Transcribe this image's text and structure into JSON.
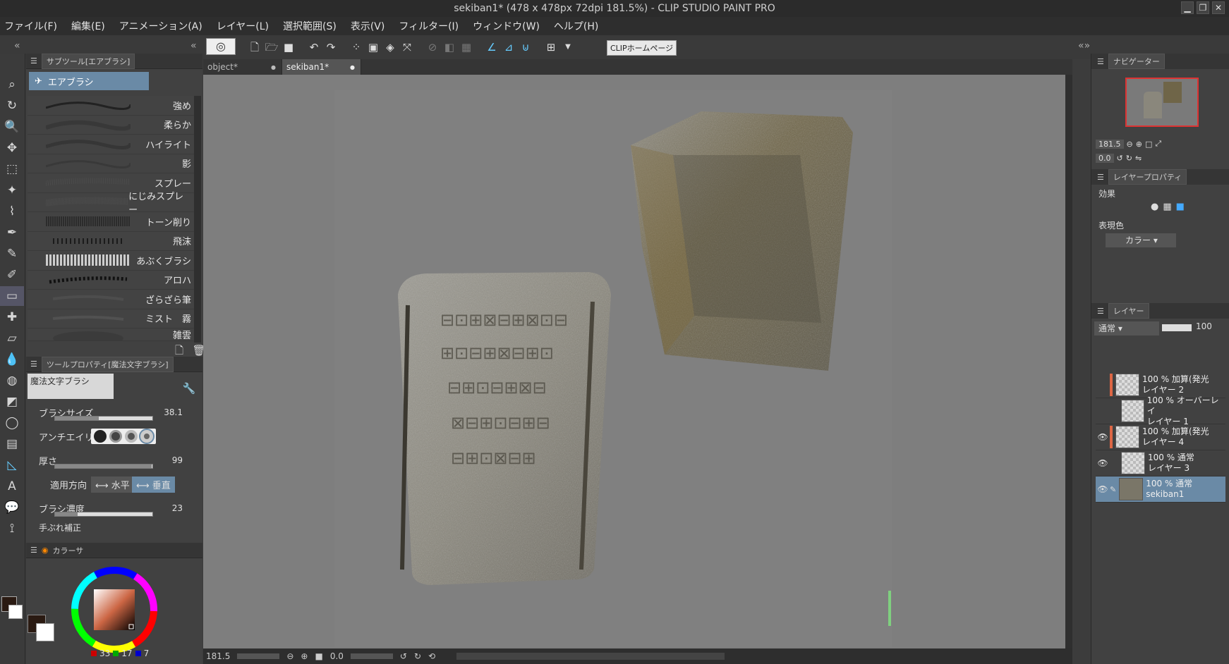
{
  "window": {
    "title": "sekiban1* (478 x 478px 72dpi 181.5%) - CLIP STUDIO PAINT PRO",
    "controls": [
      "▁",
      "❐",
      "✕"
    ]
  },
  "menu": [
    "ファイル(F)",
    "編集(E)",
    "アニメーション(A)",
    "レイヤー(L)",
    "選択範囲(S)",
    "表示(V)",
    "フィルター(I)",
    "ウィンドウ(W)",
    "ヘルプ(H)"
  ],
  "toolbar": {
    "home_button": "CLIPホームページ"
  },
  "document_tabs": [
    {
      "label": "object*",
      "close": "●"
    },
    {
      "label": "sekiban1*",
      "close": "●"
    }
  ],
  "subtool_panel": {
    "tab": "サブツール[エアブラシ]",
    "group": "エアブラシ",
    "brushes": [
      "強め",
      "柔らか",
      "ハイライト",
      "影",
      "スプレー",
      "にじみスプレー",
      "トーン削り",
      "飛沫",
      "あぶくブラシ",
      "アロハ",
      "ざらざら筆",
      "ミスト　霧",
      "雑雲"
    ]
  },
  "tool_property": {
    "tab": "ツールプロパティ[魔法文字ブラシ]",
    "preset": "魔法文字ブラシ",
    "brush_size": {
      "label": "ブラシサイズ",
      "value": "38.1",
      "level": 0.45
    },
    "antialias": {
      "label": "アンチエイリアス"
    },
    "thickness": {
      "label": "厚さ",
      "value": "99",
      "level": 0.99
    },
    "direction": {
      "label": "適用方向",
      "horizontal": "水平",
      "vertical": "垂直"
    },
    "density": {
      "label": "ブラシ濃度",
      "value": "23",
      "level": 0.23
    },
    "stabilization": {
      "label": "手ぶれ補正"
    }
  },
  "color_panel": {
    "tab": "カラーサ",
    "values": [
      "33",
      "17",
      "7"
    ],
    "main_color": "#2a1a12",
    "sub_color": "#ffffff"
  },
  "navigator": {
    "tab": "ナビゲーター",
    "zoom": "181.5",
    "rotation": "0.0"
  },
  "layer_property": {
    "tab": "レイヤープロパティ",
    "effect_label": "効果",
    "express_color_label": "表現色",
    "express_color_value": "カラー"
  },
  "layer_panel": {
    "tab": "レイヤー",
    "blend_mode": "通常",
    "opacity": "100",
    "layers": [
      {
        "mode": "100 % 加算(発光",
        "name": "レイヤー 2",
        "visible": false,
        "selected": false
      },
      {
        "mode": "100 % オーバーレイ",
        "name": "レイヤー 1",
        "visible": false,
        "selected": false
      },
      {
        "mode": "100 % 加算(発光",
        "name": "レイヤー 4",
        "visible": true,
        "selected": false
      },
      {
        "mode": "100 % 通常",
        "name": "レイヤー 3",
        "visible": true,
        "selected": false
      },
      {
        "mode": "100 % 通常",
        "name": "sekiban1",
        "visible": true,
        "selected": true
      }
    ]
  },
  "status": {
    "zoom": "181.5",
    "rotation": "0.0"
  },
  "colors": {
    "accent": "#6a8aa6",
    "canvas_bg": "#7e7e7e"
  }
}
